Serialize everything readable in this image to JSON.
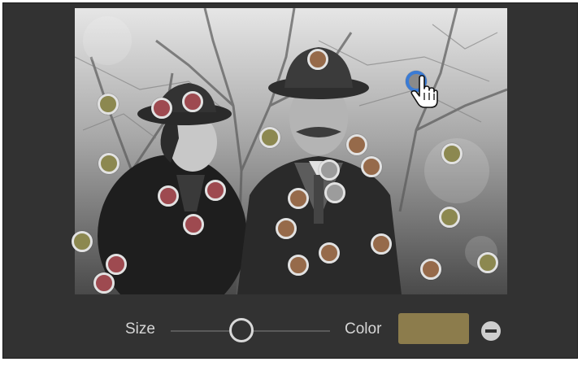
{
  "controls": {
    "size_label": "Size",
    "color_label": "Color",
    "size_value": 0.5,
    "swatch_color": "#8c7c4c"
  },
  "pin_colors": {
    "olive": "#8c8850",
    "red": "#9e4a50",
    "brown": "#966a4a",
    "gray": "#9c9c9c"
  },
  "pins": [
    {
      "color": "olive"
    },
    {
      "color": "red"
    },
    {
      "color": "red"
    },
    {
      "color": "olive"
    },
    {
      "color": "red"
    },
    {
      "color": "red"
    },
    {
      "color": "red"
    },
    {
      "color": "olive"
    },
    {
      "color": "red"
    },
    {
      "color": "red"
    },
    {
      "color": "olive"
    },
    {
      "color": "brown"
    },
    {
      "color": "brown"
    },
    {
      "color": "gray"
    },
    {
      "color": "gray"
    },
    {
      "color": "brown"
    },
    {
      "color": "brown"
    },
    {
      "color": "brown"
    },
    {
      "color": "brown"
    },
    {
      "color": "brown"
    },
    {
      "color": "brown"
    },
    {
      "color": "brown"
    },
    {
      "color": "olive"
    },
    {
      "color": "olive"
    },
    {
      "color": "olive"
    },
    {
      "color": "brown"
    }
  ],
  "active_pin": {
    "color": "blue",
    "state": "selected"
  },
  "icons": {
    "cursor": "hand-pointer-icon",
    "remove": "minus-circle-icon"
  }
}
